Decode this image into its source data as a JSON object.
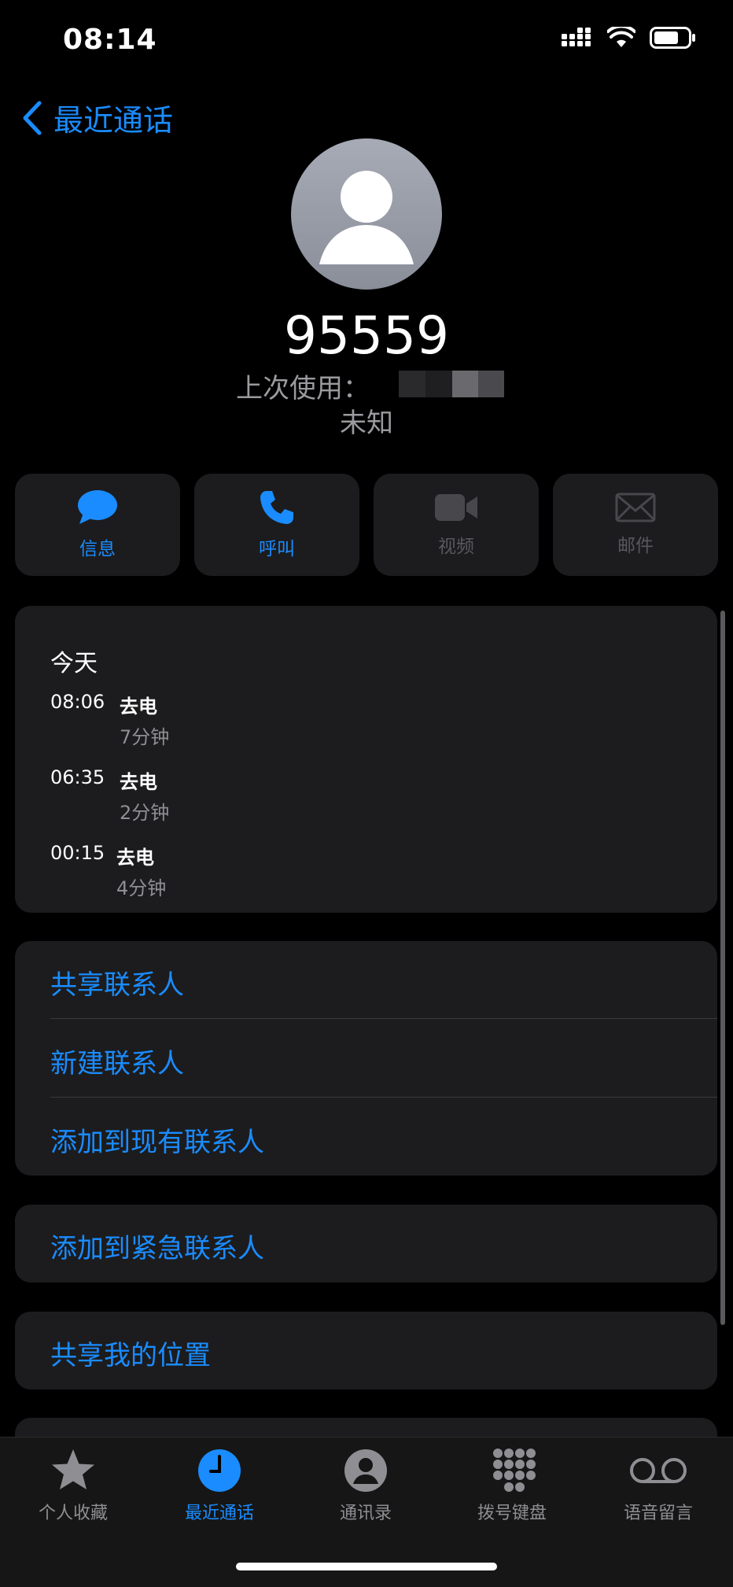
{
  "status_bar": {
    "time": "08:14"
  },
  "nav": {
    "back_label": "最近通话"
  },
  "contact": {
    "number": "95559",
    "last_used_label": "上次使用：",
    "type": "未知"
  },
  "actions": [
    {
      "label": "信息",
      "icon": "message-icon",
      "enabled": true
    },
    {
      "label": "呼叫",
      "icon": "phone-icon",
      "enabled": true
    },
    {
      "label": "视频",
      "icon": "video-icon",
      "enabled": false
    },
    {
      "label": "邮件",
      "icon": "mail-icon",
      "enabled": false
    }
  ],
  "history": {
    "day": "今天",
    "calls": [
      {
        "time": "08:06",
        "type": "去电",
        "duration": "7分钟"
      },
      {
        "time": "06:35",
        "type": "去电",
        "duration": "2分钟"
      },
      {
        "time": "00:15",
        "type": "去电",
        "duration": "4分钟"
      }
    ]
  },
  "options": {
    "share_contact": "共享联系人",
    "new_contact": "新建联系人",
    "add_existing": "添加到现有联系人",
    "add_emergency": "添加到紧急联系人",
    "share_location": "共享我的位置"
  },
  "tabs": [
    {
      "label": "个人收藏",
      "icon": "star-icon",
      "active": false
    },
    {
      "label": "最近通话",
      "icon": "clock-icon",
      "active": true
    },
    {
      "label": "通讯录",
      "icon": "person-circle-icon",
      "active": false
    },
    {
      "label": "拨号键盘",
      "icon": "keypad-icon",
      "active": false
    },
    {
      "label": "语音留言",
      "icon": "voicemail-icon",
      "active": false
    }
  ],
  "colors": {
    "accent": "#1a8cff",
    "card": "#1c1c1e",
    "secondary_text": "#8e8e93"
  }
}
